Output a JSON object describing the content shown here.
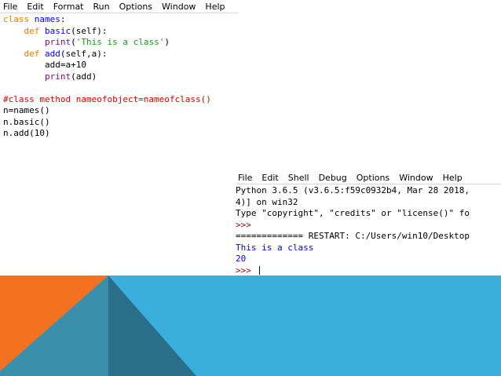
{
  "editor": {
    "menu": [
      "File",
      "Edit",
      "Format",
      "Run",
      "Options",
      "Window",
      "Help"
    ],
    "lines": [
      {
        "indent": "",
        "parts": [
          {
            "t": "class",
            "c": "kw"
          },
          {
            "t": " "
          },
          {
            "t": "names",
            "c": "nm"
          },
          {
            "t": ":"
          }
        ]
      },
      {
        "indent": "    ",
        "parts": [
          {
            "t": "def",
            "c": "kw"
          },
          {
            "t": " "
          },
          {
            "t": "basic",
            "c": "nm"
          },
          {
            "t": "(self):"
          }
        ]
      },
      {
        "indent": "        ",
        "parts": [
          {
            "t": "print",
            "c": "bi"
          },
          {
            "t": "("
          },
          {
            "t": "'This is a class'",
            "c": "st"
          },
          {
            "t": ")"
          }
        ]
      },
      {
        "indent": "    ",
        "parts": [
          {
            "t": "def",
            "c": "kw"
          },
          {
            "t": " "
          },
          {
            "t": "add",
            "c": "nm"
          },
          {
            "t": "(self,a):"
          }
        ]
      },
      {
        "indent": "        ",
        "parts": [
          {
            "t": "add=a+10"
          }
        ]
      },
      {
        "indent": "        ",
        "parts": [
          {
            "t": "print",
            "c": "bi"
          },
          {
            "t": "(add)"
          }
        ]
      },
      {
        "indent": "",
        "parts": []
      },
      {
        "indent": "",
        "parts": [
          {
            "t": "#class method nameofobject=nameofclass()",
            "c": "cm"
          }
        ]
      },
      {
        "indent": "",
        "parts": [
          {
            "t": "n=names()"
          }
        ]
      },
      {
        "indent": "",
        "parts": [
          {
            "t": "n.basic()"
          }
        ]
      },
      {
        "indent": "",
        "parts": [
          {
            "t": "n.add(10)"
          }
        ]
      }
    ]
  },
  "shell": {
    "menu": [
      "File",
      "Edit",
      "Shell",
      "Debug",
      "Options",
      "Window",
      "Help"
    ],
    "lines": [
      {
        "indent": "",
        "parts": [
          {
            "t": "Python 3.6.5 (v3.6.5:f59c0932b4, Mar 28 2018,"
          }
        ]
      },
      {
        "indent": "",
        "parts": [
          {
            "t": "4)] on win32"
          }
        ]
      },
      {
        "indent": "",
        "parts": [
          {
            "t": "Type \"copyright\", \"credits\" or \"license()\" fo"
          }
        ]
      },
      {
        "indent": "",
        "parts": [
          {
            "t": ">>>",
            "c": "pr"
          }
        ]
      },
      {
        "indent": "",
        "parts": [
          {
            "t": "============= RESTART: C:/Users/win10/Desktop"
          }
        ]
      },
      {
        "indent": "",
        "parts": [
          {
            "t": "This is a class",
            "c": "ou"
          }
        ]
      },
      {
        "indent": "",
        "parts": [
          {
            "t": "20",
            "c": "ou"
          }
        ]
      },
      {
        "indent": "",
        "parts": [
          {
            "t": ">>> ",
            "c": "pr"
          }
        ],
        "cursor": true
      }
    ]
  },
  "colors": {
    "orange": "#f47120",
    "blue": "#3aafdd",
    "teal": "#3a8fab",
    "dark_teal": "#2a6f8a"
  }
}
